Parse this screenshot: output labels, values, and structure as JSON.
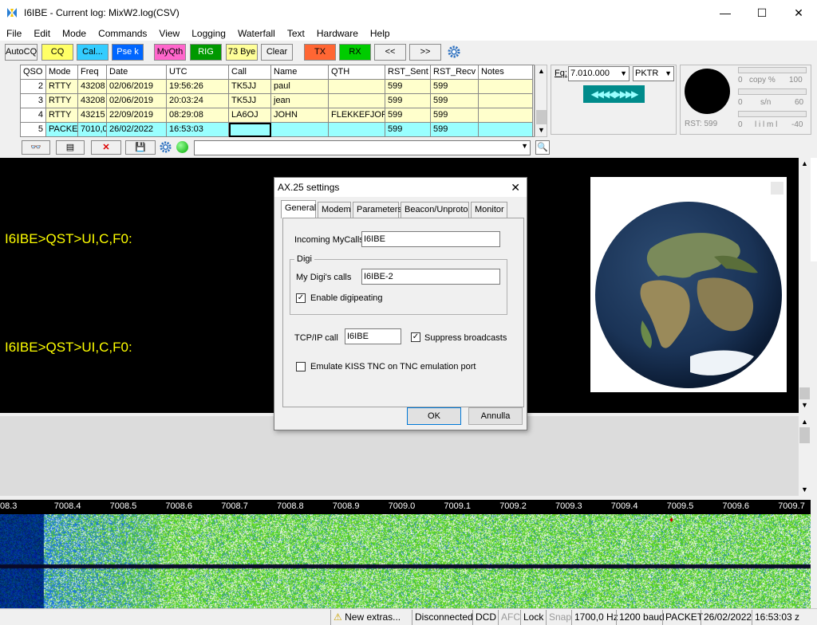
{
  "window": {
    "title": "I6IBE - Current log: MixW2.log(CSV)",
    "min": "—",
    "max": "☐",
    "close": "✕"
  },
  "menu": [
    "File",
    "Edit",
    "Mode",
    "Commands",
    "View",
    "Logging",
    "Waterfall",
    "Text",
    "Hardware",
    "Help"
  ],
  "toolbar": [
    {
      "label": "AutoCQ",
      "color": "#f0f0f0",
      "fg": "#000"
    },
    {
      "label": "CQ",
      "color": "#ffff66",
      "fg": "#000"
    },
    {
      "label": "Cal...",
      "color": "#33ccff",
      "fg": "#000"
    },
    {
      "label": "Pse k",
      "color": "#0066ff",
      "fg": "#fff"
    },
    {
      "label": "MyQth",
      "color": "#ff66cc",
      "fg": "#000"
    },
    {
      "label": "RIG",
      "color": "#009900",
      "fg": "#fff"
    },
    {
      "label": "73 Bye",
      "color": "#ffff99",
      "fg": "#000"
    },
    {
      "label": "Clear",
      "color": "#f0f0f0",
      "fg": "#000"
    },
    {
      "label": "TX",
      "color": "#ff6633",
      "fg": "#000"
    },
    {
      "label": "RX",
      "color": "#00cc00",
      "fg": "#000"
    },
    {
      "label": "<<",
      "color": "#f0f0f0",
      "fg": "#000"
    },
    {
      "label": ">>",
      "color": "#f0f0f0",
      "fg": "#000"
    }
  ],
  "grid": {
    "headers": [
      "QSO",
      "Mode",
      "Freq",
      "Date",
      "UTC",
      "Call",
      "Name",
      "QTH",
      "RST_Sent",
      "RST_Recv",
      "Notes"
    ],
    "rows": [
      [
        "2",
        "RTTY",
        "43208",
        "02/06/2019",
        "19:56:26",
        "TK5JJ",
        "paul",
        "",
        "599",
        "599",
        ""
      ],
      [
        "3",
        "RTTY",
        "43208",
        "02/06/2019",
        "20:03:24",
        "TK5JJ",
        "jean",
        "",
        "599",
        "599",
        ""
      ],
      [
        "4",
        "RTTY",
        "43215",
        "22/09/2019",
        "08:29:08",
        "LA6OJ",
        "JOHN",
        "FLEKKEFJOR",
        "599",
        "599",
        ""
      ],
      [
        "5",
        "PACKE",
        "7010,0",
        "26/02/2022",
        "16:53:03",
        "",
        "",
        "",
        "599",
        "599",
        ""
      ]
    ]
  },
  "freq": {
    "label": "Fq:",
    "value": "7.010.000",
    "mode": "PKTR"
  },
  "meters": {
    "copy_min": "0",
    "copy_label": "copy %",
    "copy_max": "100",
    "sn_min": "0",
    "sn_label": "s/n",
    "sn_max": "60",
    "lim_min": "0",
    "lim_label": "l i l m l",
    "lim_max": "-40",
    "rst": "RST: 599"
  },
  "rx_lines": [
    "I6IBE>QST>UI,C,F0:",
    "I6IBE>QST>UI,C,F0:"
  ],
  "waterfall_ticks": [
    "08.3",
    "7008.4",
    "7008.5",
    "7008.6",
    "7008.7",
    "7008.8",
    "7008.9",
    "7009.0",
    "7009.1",
    "7009.2",
    "7009.3",
    "7009.4",
    "7009.5",
    "7009.6",
    "7009.7"
  ],
  "status": [
    "New extras...",
    "Disconnected",
    "DCD",
    "AFC",
    "Lock",
    "Snap",
    "1700,0 Hz",
    "1200 baud",
    "PACKET",
    "26/02/2022",
    "16:53:03 z"
  ],
  "dialog": {
    "title": "AX.25 settings",
    "tabs": [
      "General",
      "Modem",
      "Parameters",
      "Beacon/Unproto",
      "Monitor"
    ],
    "incoming_label": "Incoming MyCalls",
    "incoming_value": "I6IBE",
    "digi_group": "Digi",
    "digi_label": "My Digi's calls",
    "digi_value": "I6IBE-2",
    "enable_digi": "Enable digipeating",
    "tcp_label": "TCP/IP call",
    "tcp_value": "I6IBE",
    "suppress": "Suppress broadcasts",
    "emulate": "Emulate KISS TNC on TNC emulation port",
    "ok": "OK",
    "cancel": "Annulla"
  }
}
